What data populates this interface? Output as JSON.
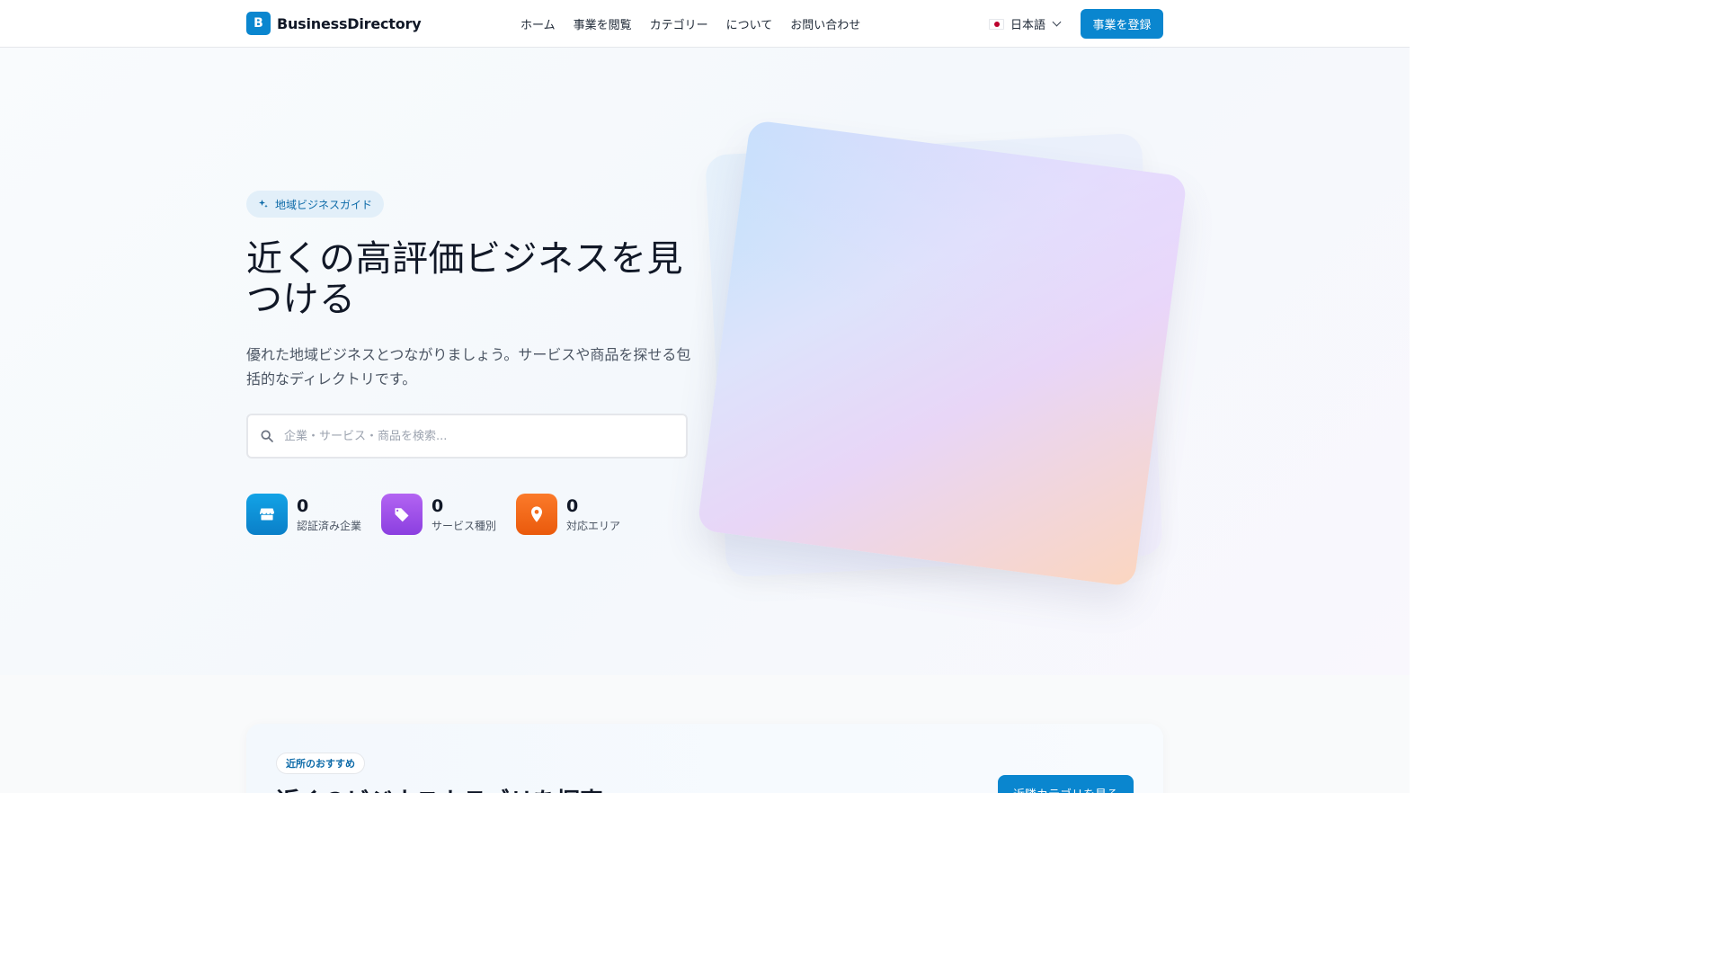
{
  "header": {
    "logo_letter": "B",
    "logo_text": "BusinessDirectory",
    "nav": [
      "ホーム",
      "事業を閲覧",
      "カテゴリー",
      "について",
      "お問い合わせ"
    ],
    "language": "日本語",
    "register_label": "事業を登録"
  },
  "hero": {
    "pill": "地域ビジネスガイド",
    "headline": "近くの高評価ビジネスを見つける",
    "subtext": "優れた地域ビジネスとつながりましょう。サービスや商品を探せる包括的なディレクトリです。",
    "search_placeholder": "企業・サービス・商品を検索...",
    "stats": [
      {
        "value": "0",
        "label": "認証済み企業",
        "icon": "store-icon",
        "color": "#0a86cf"
      },
      {
        "value": "0",
        "label": "サービス種別",
        "icon": "tag-icon",
        "color": "#9b4ee8"
      },
      {
        "value": "0",
        "label": "対応エリア",
        "icon": "map-pin-icon",
        "color": "#f26b1d"
      }
    ]
  },
  "explore": {
    "pill": "近所のおすすめ",
    "title": "近くのビジネスカテゴリを探索",
    "button_label": "近隣カテゴリを見る"
  },
  "colors": {
    "primary": "#0a86cf",
    "purple": "#9b4ee8",
    "orange": "#f26b1d"
  }
}
